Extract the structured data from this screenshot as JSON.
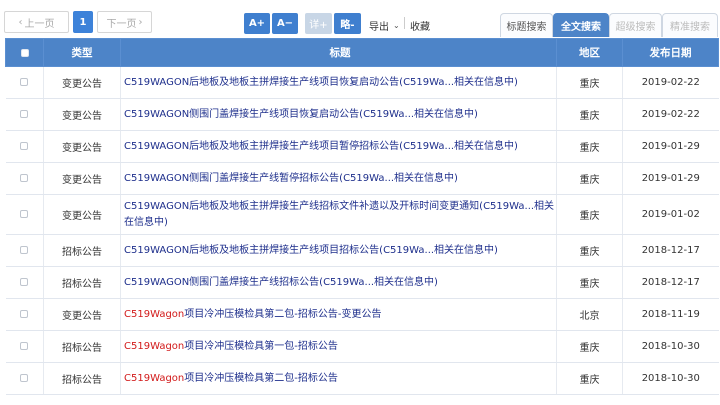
{
  "pager": {
    "prev": "上一页",
    "current": "1",
    "next": "下一页"
  },
  "controls": {
    "font_increase": "A+",
    "font_decrease": "A−",
    "view_detail": "详+",
    "view_brief": "略-",
    "export": "导出",
    "collect": "收藏"
  },
  "tabs": [
    {
      "label": "标题搜索",
      "active": false
    },
    {
      "label": "全文搜索",
      "active": true
    },
    {
      "label": "超级搜索",
      "active": false
    },
    {
      "label": "精准搜索",
      "active": false
    }
  ],
  "table": {
    "headers": {
      "type": "类型",
      "title": "标题",
      "area": "地区",
      "date": "发布日期"
    },
    "rows": [
      {
        "type": "变更公告",
        "title_prefix": "",
        "title": "C519WAGON后地板及地板主拼焊接生产线项目恢复启动公告(C519Wa...相关在信息中)",
        "area": "重庆",
        "date": "2019-02-22"
      },
      {
        "type": "变更公告",
        "title_prefix": "",
        "title": "C519WAGON侧围门盖焊接生产线项目恢复启动公告(C519Wa...相关在信息中)",
        "area": "重庆",
        "date": "2019-02-22"
      },
      {
        "type": "变更公告",
        "title_prefix": "",
        "title": "C519WAGON后地板及地板主拼焊接生产线项目暂停招标公告(C519Wa...相关在信息中)",
        "area": "重庆",
        "date": "2019-01-29"
      },
      {
        "type": "变更公告",
        "title_prefix": "",
        "title": "C519WAGON侧围门盖焊接生产线暂停招标公告(C519Wa...相关在信息中)",
        "area": "重庆",
        "date": "2019-01-29"
      },
      {
        "type": "变更公告",
        "title_prefix": "",
        "title": "C519WAGON后地板及地板主拼焊接生产线招标文件补遗以及开标时间变更通知(C519Wa...相关在信息中)",
        "area": "重庆",
        "date": "2019-01-02"
      },
      {
        "type": "招标公告",
        "title_prefix": "",
        "title": "C519WAGON后地板及地板主拼焊接生产线项目招标公告(C519Wa...相关在信息中)",
        "area": "重庆",
        "date": "2018-12-17"
      },
      {
        "type": "招标公告",
        "title_prefix": "",
        "title": "C519WAGON侧围门盖焊接生产线招标公告(C519Wa...相关在信息中)",
        "area": "重庆",
        "date": "2018-12-17"
      },
      {
        "type": "变更公告",
        "title_prefix": "C519Wagon",
        "title": "项目冷冲压模检具第二包-招标公告-变更公告",
        "area": "北京",
        "date": "2018-11-19"
      },
      {
        "type": "招标公告",
        "title_prefix": "C519Wagon",
        "title": "项目冷冲压模检具第一包-招标公告",
        "area": "重庆",
        "date": "2018-10-30"
      },
      {
        "type": "招标公告",
        "title_prefix": "C519Wagon",
        "title": "项目冷冲压模检具第二包-招标公告",
        "area": "重庆",
        "date": "2018-10-30"
      }
    ]
  },
  "colors": {
    "accent": "#4d84c8",
    "link": "#1e2f8c",
    "highlight": "#d21a1a"
  },
  "icons": {
    "prev": "chevron-left-icon",
    "next": "chevron-right-icon",
    "export_dropdown": "chevron-down-icon"
  }
}
